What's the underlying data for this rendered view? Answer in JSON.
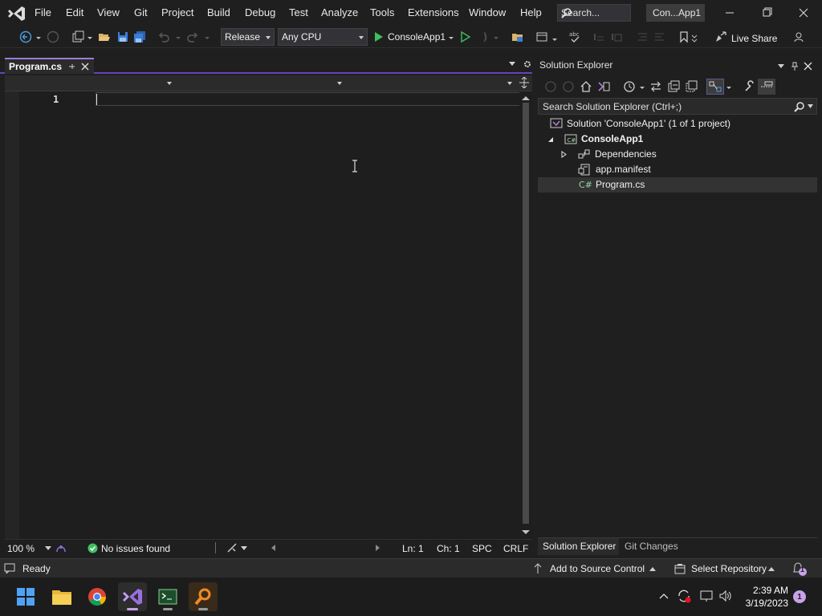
{
  "menu": {
    "items": [
      "File",
      "Edit",
      "View",
      "Git",
      "Project",
      "Build",
      "Debug",
      "Test",
      "Analyze",
      "Tools",
      "Extensions",
      "Window",
      "Help"
    ],
    "search_placeholder": "Search...",
    "solution_name": "Con...App1"
  },
  "toolbar": {
    "configuration": "Release",
    "platform": "Any CPU",
    "start_target": "ConsoleApp1",
    "live_share": "Live Share"
  },
  "editor": {
    "tab_name": "Program.cs",
    "line_number": "1",
    "zoom": "100 %",
    "issues": "No issues found",
    "ln": "Ln: 1",
    "ch": "Ch: 1",
    "spc": "SPC",
    "crlf": "CRLF"
  },
  "solution_explorer": {
    "title": "Solution Explorer",
    "search_placeholder": "Search Solution Explorer (Ctrl+;)",
    "solution": "Solution 'ConsoleApp1' (1 of 1 project)",
    "project": "ConsoleApp1",
    "items": [
      "Dependencies",
      "app.manifest",
      "Program.cs"
    ],
    "tabs": [
      "Solution Explorer",
      "Git Changes"
    ]
  },
  "statusbar": {
    "ready": "Ready",
    "add_source_control": "Add to Source Control",
    "select_repository": "Select Repository",
    "notifications": "1"
  },
  "taskbar": {
    "time": "2:39 AM",
    "date": "3/19/2023",
    "notification_count": "1"
  },
  "colors": {
    "accent": "#6f3fbf",
    "run_green": "#3fbf5f",
    "badge": "#c8a2e8"
  }
}
